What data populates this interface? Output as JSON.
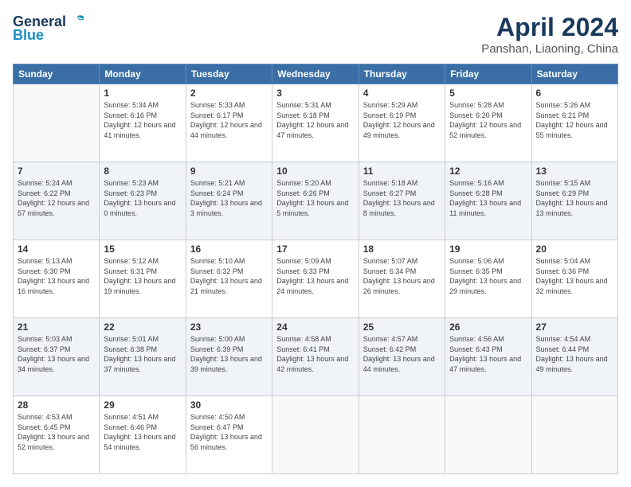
{
  "logo": {
    "line1": "General",
    "line2": "Blue"
  },
  "title": "April 2024",
  "subtitle": "Panshan, Liaoning, China",
  "days_header": [
    "Sunday",
    "Monday",
    "Tuesday",
    "Wednesday",
    "Thursday",
    "Friday",
    "Saturday"
  ],
  "weeks": [
    [
      {
        "num": "",
        "sunrise": "",
        "sunset": "",
        "daylight": ""
      },
      {
        "num": "1",
        "sunrise": "Sunrise: 5:34 AM",
        "sunset": "Sunset: 6:16 PM",
        "daylight": "Daylight: 12 hours and 41 minutes."
      },
      {
        "num": "2",
        "sunrise": "Sunrise: 5:33 AM",
        "sunset": "Sunset: 6:17 PM",
        "daylight": "Daylight: 12 hours and 44 minutes."
      },
      {
        "num": "3",
        "sunrise": "Sunrise: 5:31 AM",
        "sunset": "Sunset: 6:18 PM",
        "daylight": "Daylight: 12 hours and 47 minutes."
      },
      {
        "num": "4",
        "sunrise": "Sunrise: 5:29 AM",
        "sunset": "Sunset: 6:19 PM",
        "daylight": "Daylight: 12 hours and 49 minutes."
      },
      {
        "num": "5",
        "sunrise": "Sunrise: 5:28 AM",
        "sunset": "Sunset: 6:20 PM",
        "daylight": "Daylight: 12 hours and 52 minutes."
      },
      {
        "num": "6",
        "sunrise": "Sunrise: 5:26 AM",
        "sunset": "Sunset: 6:21 PM",
        "daylight": "Daylight: 12 hours and 55 minutes."
      }
    ],
    [
      {
        "num": "7",
        "sunrise": "Sunrise: 5:24 AM",
        "sunset": "Sunset: 6:22 PM",
        "daylight": "Daylight: 12 hours and 57 minutes."
      },
      {
        "num": "8",
        "sunrise": "Sunrise: 5:23 AM",
        "sunset": "Sunset: 6:23 PM",
        "daylight": "Daylight: 13 hours and 0 minutes."
      },
      {
        "num": "9",
        "sunrise": "Sunrise: 5:21 AM",
        "sunset": "Sunset: 6:24 PM",
        "daylight": "Daylight: 13 hours and 3 minutes."
      },
      {
        "num": "10",
        "sunrise": "Sunrise: 5:20 AM",
        "sunset": "Sunset: 6:26 PM",
        "daylight": "Daylight: 13 hours and 5 minutes."
      },
      {
        "num": "11",
        "sunrise": "Sunrise: 5:18 AM",
        "sunset": "Sunset: 6:27 PM",
        "daylight": "Daylight: 13 hours and 8 minutes."
      },
      {
        "num": "12",
        "sunrise": "Sunrise: 5:16 AM",
        "sunset": "Sunset: 6:28 PM",
        "daylight": "Daylight: 13 hours and 11 minutes."
      },
      {
        "num": "13",
        "sunrise": "Sunrise: 5:15 AM",
        "sunset": "Sunset: 6:29 PM",
        "daylight": "Daylight: 13 hours and 13 minutes."
      }
    ],
    [
      {
        "num": "14",
        "sunrise": "Sunrise: 5:13 AM",
        "sunset": "Sunset: 6:30 PM",
        "daylight": "Daylight: 13 hours and 16 minutes."
      },
      {
        "num": "15",
        "sunrise": "Sunrise: 5:12 AM",
        "sunset": "Sunset: 6:31 PM",
        "daylight": "Daylight: 13 hours and 19 minutes."
      },
      {
        "num": "16",
        "sunrise": "Sunrise: 5:10 AM",
        "sunset": "Sunset: 6:32 PM",
        "daylight": "Daylight: 13 hours and 21 minutes."
      },
      {
        "num": "17",
        "sunrise": "Sunrise: 5:09 AM",
        "sunset": "Sunset: 6:33 PM",
        "daylight": "Daylight: 13 hours and 24 minutes."
      },
      {
        "num": "18",
        "sunrise": "Sunrise: 5:07 AM",
        "sunset": "Sunset: 6:34 PM",
        "daylight": "Daylight: 13 hours and 26 minutes."
      },
      {
        "num": "19",
        "sunrise": "Sunrise: 5:06 AM",
        "sunset": "Sunset: 6:35 PM",
        "daylight": "Daylight: 13 hours and 29 minutes."
      },
      {
        "num": "20",
        "sunrise": "Sunrise: 5:04 AM",
        "sunset": "Sunset: 6:36 PM",
        "daylight": "Daylight: 13 hours and 32 minutes."
      }
    ],
    [
      {
        "num": "21",
        "sunrise": "Sunrise: 5:03 AM",
        "sunset": "Sunset: 6:37 PM",
        "daylight": "Daylight: 13 hours and 34 minutes."
      },
      {
        "num": "22",
        "sunrise": "Sunrise: 5:01 AM",
        "sunset": "Sunset: 6:38 PM",
        "daylight": "Daylight: 13 hours and 37 minutes."
      },
      {
        "num": "23",
        "sunrise": "Sunrise: 5:00 AM",
        "sunset": "Sunset: 6:39 PM",
        "daylight": "Daylight: 13 hours and 39 minutes."
      },
      {
        "num": "24",
        "sunrise": "Sunrise: 4:58 AM",
        "sunset": "Sunset: 6:41 PM",
        "daylight": "Daylight: 13 hours and 42 minutes."
      },
      {
        "num": "25",
        "sunrise": "Sunrise: 4:57 AM",
        "sunset": "Sunset: 6:42 PM",
        "daylight": "Daylight: 13 hours and 44 minutes."
      },
      {
        "num": "26",
        "sunrise": "Sunrise: 4:56 AM",
        "sunset": "Sunset: 6:43 PM",
        "daylight": "Daylight: 13 hours and 47 minutes."
      },
      {
        "num": "27",
        "sunrise": "Sunrise: 4:54 AM",
        "sunset": "Sunset: 6:44 PM",
        "daylight": "Daylight: 13 hours and 49 minutes."
      }
    ],
    [
      {
        "num": "28",
        "sunrise": "Sunrise: 4:53 AM",
        "sunset": "Sunset: 6:45 PM",
        "daylight": "Daylight: 13 hours and 52 minutes."
      },
      {
        "num": "29",
        "sunrise": "Sunrise: 4:51 AM",
        "sunset": "Sunset: 6:46 PM",
        "daylight": "Daylight: 13 hours and 54 minutes."
      },
      {
        "num": "30",
        "sunrise": "Sunrise: 4:50 AM",
        "sunset": "Sunset: 6:47 PM",
        "daylight": "Daylight: 13 hours and 56 minutes."
      },
      {
        "num": "",
        "sunrise": "",
        "sunset": "",
        "daylight": ""
      },
      {
        "num": "",
        "sunrise": "",
        "sunset": "",
        "daylight": ""
      },
      {
        "num": "",
        "sunrise": "",
        "sunset": "",
        "daylight": ""
      },
      {
        "num": "",
        "sunrise": "",
        "sunset": "",
        "daylight": ""
      }
    ]
  ]
}
